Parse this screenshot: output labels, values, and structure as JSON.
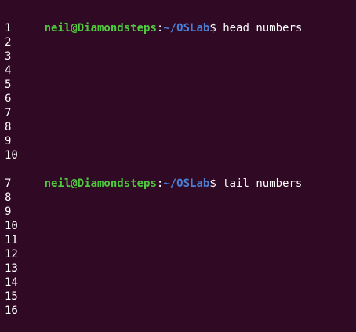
{
  "terminal": {
    "prompt": {
      "user_host": "neil@Diamondsteps",
      "colon": ":",
      "path": "~/OSLab",
      "dollar": "$"
    },
    "commands": {
      "head": "head numbers",
      "tail": "tail numbers"
    },
    "top_partial_line": "",
    "head_output": [
      "1",
      "2",
      "3",
      "4",
      "5",
      "6",
      "7",
      "8",
      "9",
      "10"
    ],
    "tail_output": [
      "7",
      "8",
      "9",
      "10",
      "11",
      "12",
      "13",
      "14",
      "15",
      "16"
    ]
  },
  "colors": {
    "background": "#300a24",
    "user_host": "#4fca3f",
    "path": "#4b7fd6",
    "text": "#ffffff"
  }
}
